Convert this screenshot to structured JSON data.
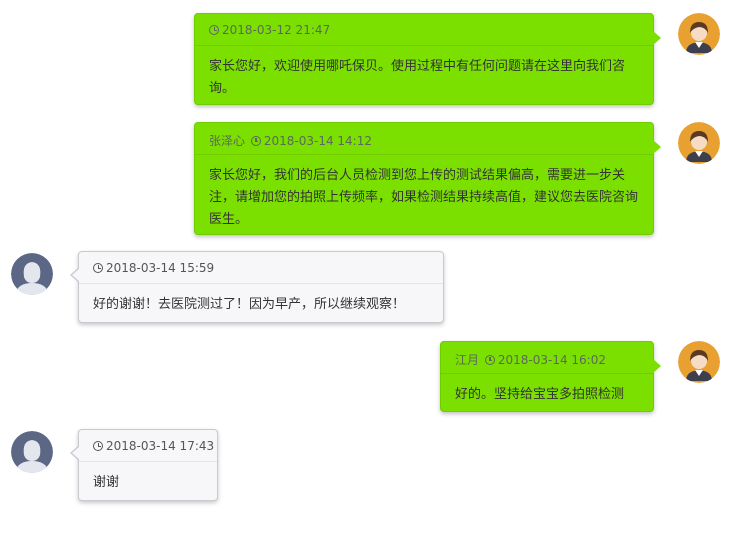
{
  "colors": {
    "outgoing_bubble": "#7be000",
    "incoming_bubble": "#f7f7f9",
    "staff_avatar_bg": "#e8a030",
    "user_avatar_bg": "#5c6785"
  },
  "messages": [
    {
      "direction": "outgoing",
      "avatar_icon": "staff-avatar-icon",
      "sender": "",
      "time": "2018-03-12 21:47",
      "text": "家长您好，欢迎使用哪吒保贝。使用过程中有任何问题请在这里向我们咨询。"
    },
    {
      "direction": "outgoing",
      "avatar_icon": "staff-avatar-icon",
      "sender": "张泽心",
      "time": "2018-03-14 14:12",
      "text": "家长您好，我们的后台人员检测到您上传的测试结果偏高，需要进一步关注，请增加您的拍照上传频率，如果检测结果持续高值，建议您去医院咨询医生。"
    },
    {
      "direction": "incoming",
      "avatar_icon": "user-avatar-icon",
      "sender": "",
      "time": "2018-03-14 15:59",
      "text": "好的谢谢！去医院测过了！因为早产，所以继续观察！"
    },
    {
      "direction": "outgoing",
      "avatar_icon": "staff-avatar-icon",
      "sender": "江月",
      "time": "2018-03-14 16:02",
      "text": "好的。坚持给宝宝多拍照检测"
    },
    {
      "direction": "incoming",
      "avatar_icon": "user-avatar-icon",
      "sender": "",
      "time": "2018-03-14 17:43",
      "text": "谢谢"
    }
  ]
}
